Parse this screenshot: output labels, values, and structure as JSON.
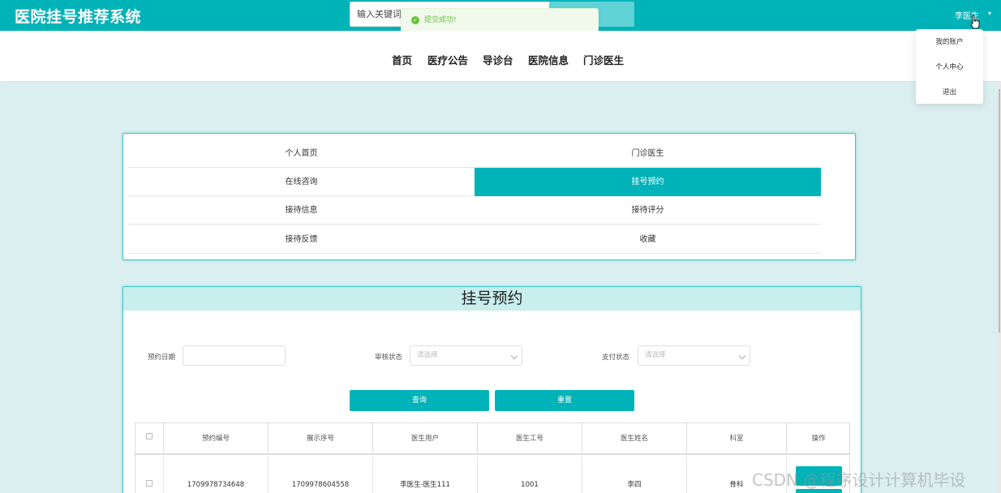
{
  "header": {
    "brand": "医院挂号推荐系统",
    "search_placeholder": "输入关键词",
    "user": "李医生"
  },
  "toast": {
    "message": "提交成功!"
  },
  "nav": {
    "items": [
      "首页",
      "医疗公告",
      "导诊台",
      "医院信息",
      "门诊医生"
    ]
  },
  "dropdown": {
    "items": [
      "我的账户",
      "个人中心",
      "退出"
    ]
  },
  "menu": {
    "items": [
      "个人首页",
      "门诊医生",
      "在线咨询",
      "挂号预约",
      "接待信息",
      "接待评分",
      "接待反馈",
      "收藏"
    ],
    "active": "挂号预约"
  },
  "panel": {
    "title": "挂号预约",
    "filters": {
      "date_label": "预约日期",
      "audit_label": "审核状态",
      "audit_placeholder": "请选择",
      "pay_label": "支付状态",
      "pay_placeholder": "请选择"
    },
    "buttons": {
      "query": "查询",
      "reset": "重置"
    },
    "table": {
      "headers": [
        "预约编号",
        "展示序号",
        "医生用户",
        "医生工号",
        "医生姓名",
        "科室",
        "操作"
      ],
      "rows": [
        [
          "1709978734648",
          "1709978604558",
          "李医生-医生111",
          "1001",
          "李四",
          "骨科"
        ]
      ]
    }
  },
  "watermark": "CSDN @程序设计计算机毕设",
  "colors": {
    "accent": "#00b3b8",
    "background": "#dceff0",
    "panel_head": "#c8eeee",
    "success": "#67c23a"
  }
}
